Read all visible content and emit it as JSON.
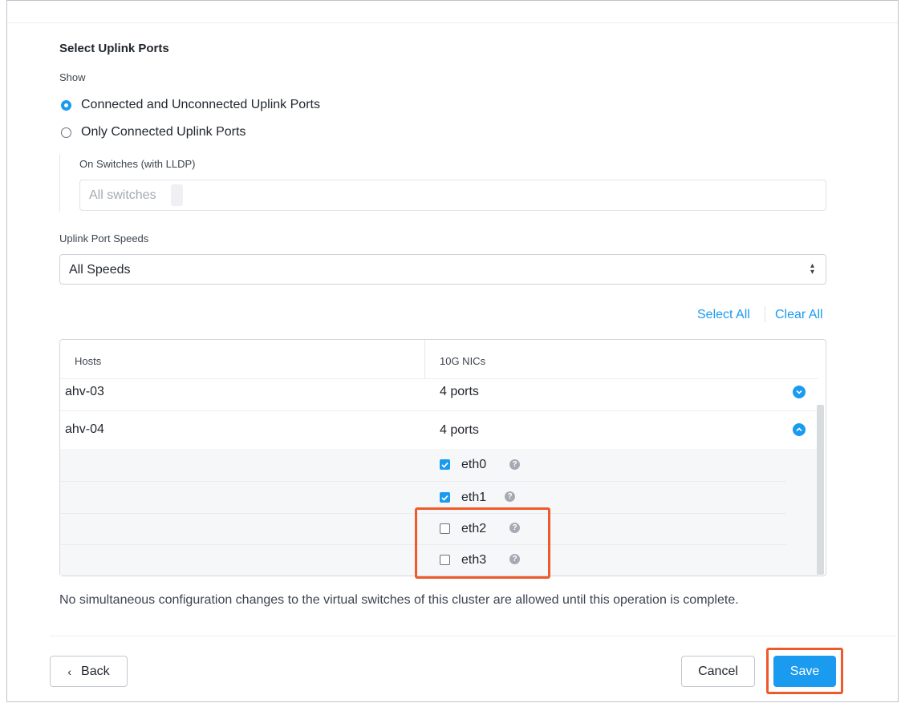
{
  "form": {
    "title": "Select Uplink Ports",
    "show_label": "Show",
    "radio_options": [
      {
        "label": "Connected and Unconnected Uplink Ports",
        "selected": true
      },
      {
        "label": "Only Connected Uplink Ports",
        "selected": false
      }
    ],
    "switches_label": "On Switches (with LLDP)",
    "switches_placeholder": "All switches",
    "speed_label": "Uplink Port Speeds",
    "speed_value": "All Speeds"
  },
  "actions": {
    "select_all": "Select All",
    "clear_all": "Clear All"
  },
  "table": {
    "headers": [
      "Hosts",
      "10G NICs"
    ],
    "rows": [
      {
        "host": "ahv-03",
        "ports": "4 ports",
        "expanded": false
      },
      {
        "host": "ahv-04",
        "ports": "4 ports",
        "expanded": true
      }
    ],
    "nics": [
      {
        "name": "eth0",
        "checked": true
      },
      {
        "name": "eth1",
        "checked": true
      },
      {
        "name": "eth2",
        "checked": false
      },
      {
        "name": "eth3",
        "checked": false
      }
    ]
  },
  "notice": "No simultaneous configuration changes to the virtual switches of this cluster are allowed until this operation is complete.",
  "footer": {
    "back": "Back",
    "cancel": "Cancel",
    "save": "Save"
  },
  "colors": {
    "accent": "#1b9bf0",
    "highlight": "#ee5a2a"
  }
}
